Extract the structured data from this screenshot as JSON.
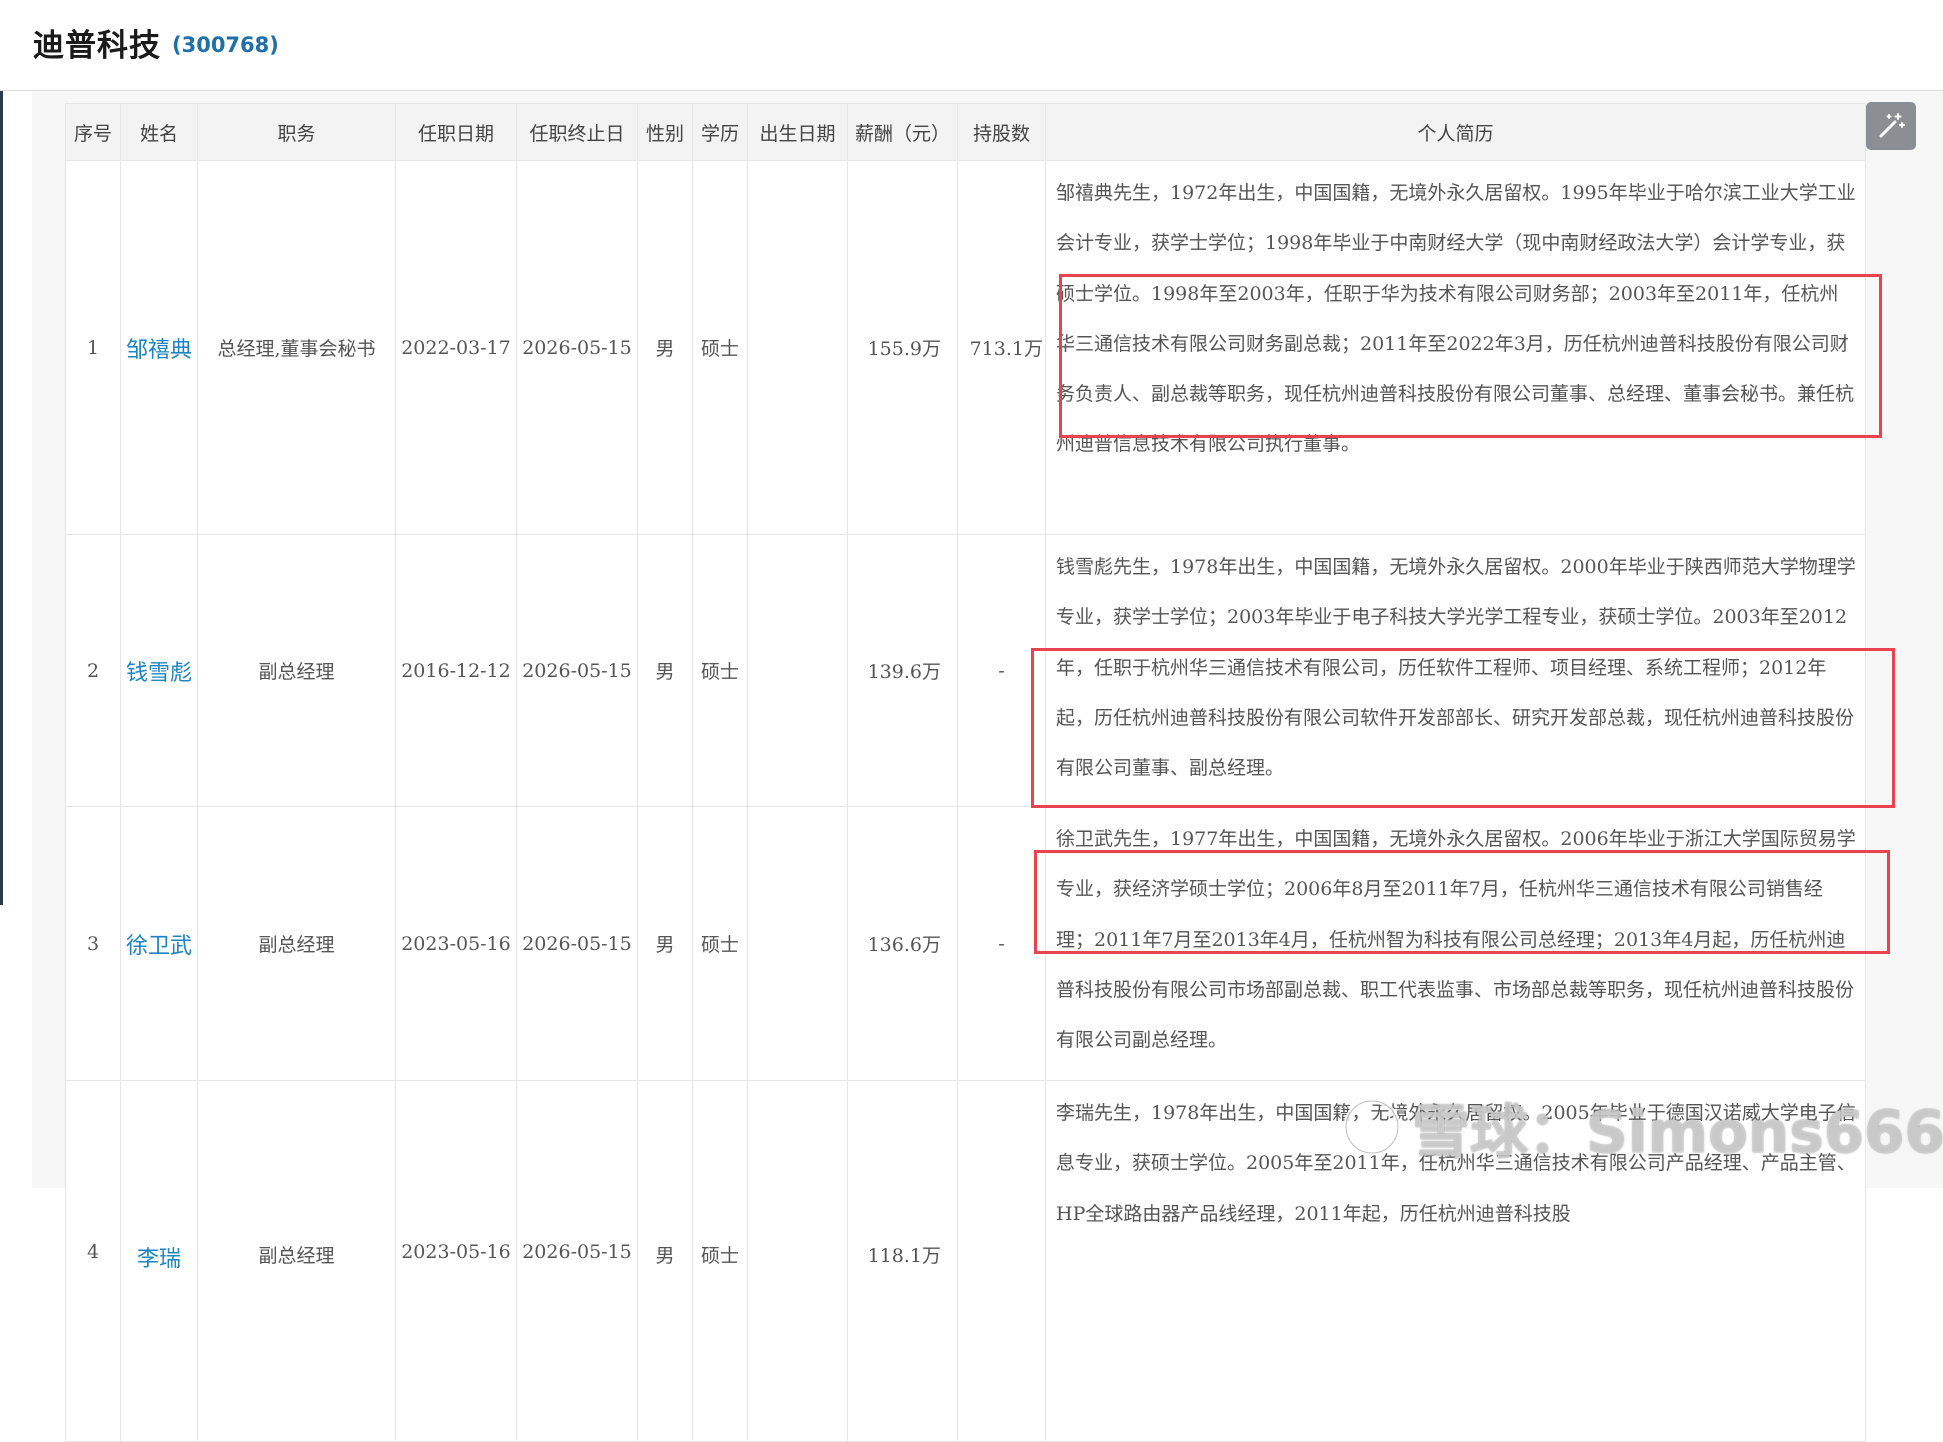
{
  "header": {
    "company": "迪普科技",
    "code": "(300768)"
  },
  "columns": [
    "序号",
    "姓名",
    "职务",
    "任职日期",
    "任职终止日",
    "性别",
    "学历",
    "出生日期",
    "薪酬（元）",
    "持股数",
    "个人简历"
  ],
  "rows": [
    {
      "index": "1",
      "name": "邹禧典",
      "position": "总经理,董事会秘书",
      "start": "2022-03-17",
      "end": "2026-05-15",
      "gender": "男",
      "education": "硕士",
      "birth": "",
      "salary": "155.9万",
      "shares": "713.1万",
      "bio": "邹禧典先生，1972年出生，中国国籍，无境外永久居留权。1995年毕业于哈尔滨工业大学工业会计专业，获学士学位；1998年毕业于中南财经大学（现中南财经政法大学）会计学专业，获硕士学位。1998年至2003年，任职于华为技术有限公司财务部；2003年至2011年，任杭州华三通信技术有限公司财务副总裁；2011年至2022年3月，历任杭州迪普科技股份有限公司财务负责人、副总裁等职务，现任杭州迪普科技股份有限公司董事、总经理、董事会秘书。兼任杭州迪普信息技术有限公司执行董事。"
    },
    {
      "index": "2",
      "name": "钱雪彪",
      "position": "副总经理",
      "start": "2016-12-12",
      "end": "2026-05-15",
      "gender": "男",
      "education": "硕士",
      "birth": "",
      "salary": "139.6万",
      "shares": "-",
      "bio": "钱雪彪先生，1978年出生，中国国籍，无境外永久居留权。2000年毕业于陕西师范大学物理学专业，获学士学位；2003年毕业于电子科技大学光学工程专业，获硕士学位。2003年至2012年，任职于杭州华三通信技术有限公司，历任软件工程师、项目经理、系统工程师；2012年起，历任杭州迪普科技股份有限公司软件开发部部长、研究开发部总裁，现任杭州迪普科技股份有限公司董事、副总经理。"
    },
    {
      "index": "3",
      "name": "徐卫武",
      "position": "副总经理",
      "start": "2023-05-16",
      "end": "2026-05-15",
      "gender": "男",
      "education": "硕士",
      "birth": "",
      "salary": "136.6万",
      "shares": "-",
      "bio": "徐卫武先生，1977年出生，中国国籍，无境外永久居留权。2006年毕业于浙江大学国际贸易学专业，获经济学硕士学位；2006年8月至2011年7月，任杭州华三通信技术有限公司销售经理；2011年7月至2013年4月，任杭州智为科技有限公司总经理；2013年4月起，历任杭州迪普科技股份有限公司市场部副总裁、职工代表监事、市场部总裁等职务，现任杭州迪普科技股份有限公司副总经理。"
    },
    {
      "index": "4",
      "name": "李瑞",
      "position": "副总经理",
      "start": "2023-05-16",
      "end": "2026-05-15",
      "gender": "男",
      "education": "硕士",
      "birth": "",
      "salary": "118.1万",
      "shares": "",
      "bio": "李瑞先生，1978年出生，中国国籍，无境外永久居留权。2005年毕业于德国汉诺威大学电子信息专业，获硕士学位。2005年至2011年，任杭州华三通信技术有限公司产品经理、产品主管、HP全球路由器产品线经理，2011年起，历任杭州迪普科技股"
    }
  ],
  "watermark": "雪球：Simons666",
  "colors": {
    "link": "#1b84c4",
    "highlight_box": "#e8434f",
    "code": "#1f6fa8"
  },
  "icons": {
    "magic": "magic-wand-icon",
    "watermark_logo": "snowball-logo"
  }
}
